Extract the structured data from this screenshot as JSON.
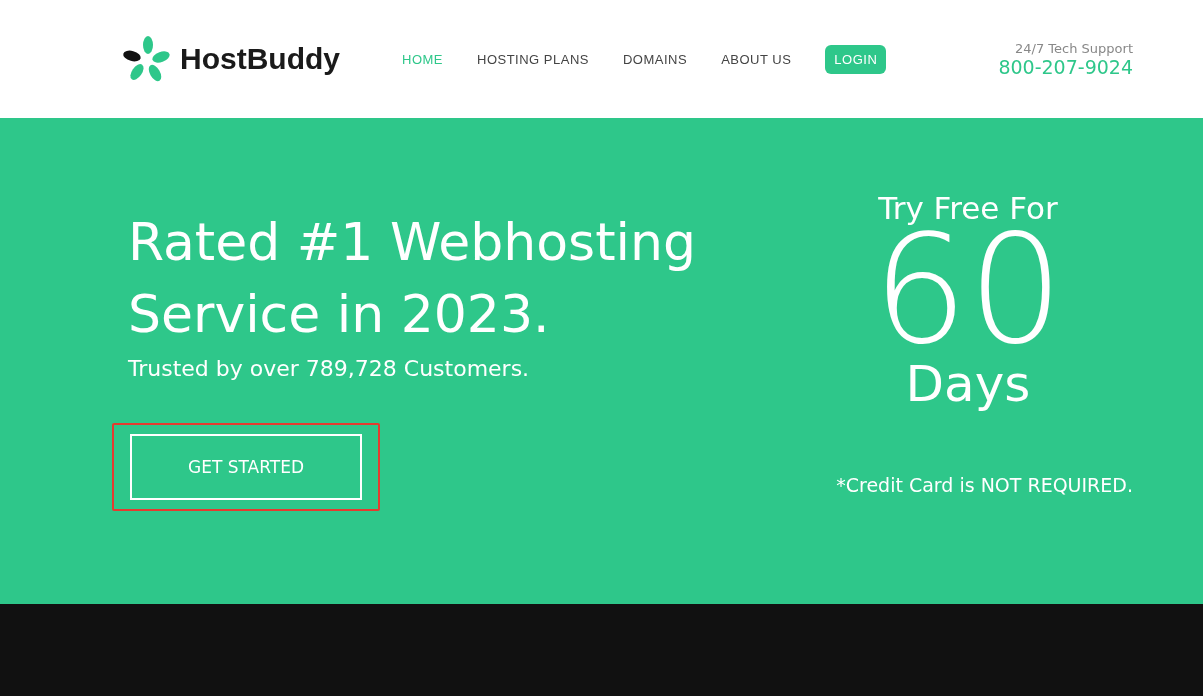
{
  "brand": {
    "name": "HostBuddy"
  },
  "nav": [
    {
      "label": "HOME",
      "selected": true,
      "kind": "link"
    },
    {
      "label": "HOSTING PLANS",
      "selected": false,
      "kind": "link"
    },
    {
      "label": "DOMAINS",
      "selected": false,
      "kind": "link"
    },
    {
      "label": "ABOUT US",
      "selected": false,
      "kind": "link"
    },
    {
      "label": "LOGIN",
      "selected": false,
      "kind": "button"
    }
  ],
  "support": {
    "label": "24/7 Tech Support",
    "phone": "800-207-9024"
  },
  "hero": {
    "title_lines": [
      "Rated #1 Webhosting",
      "Service in 2023."
    ],
    "subtitle": "Trusted by over 789,728 Customers.",
    "cta": "GET STARTED",
    "cta_highlighted": true,
    "offer": {
      "prefix": "Try Free For",
      "number": "60",
      "unit": "Days",
      "note": "*Credit Card is NOT REQUIRED."
    }
  }
}
